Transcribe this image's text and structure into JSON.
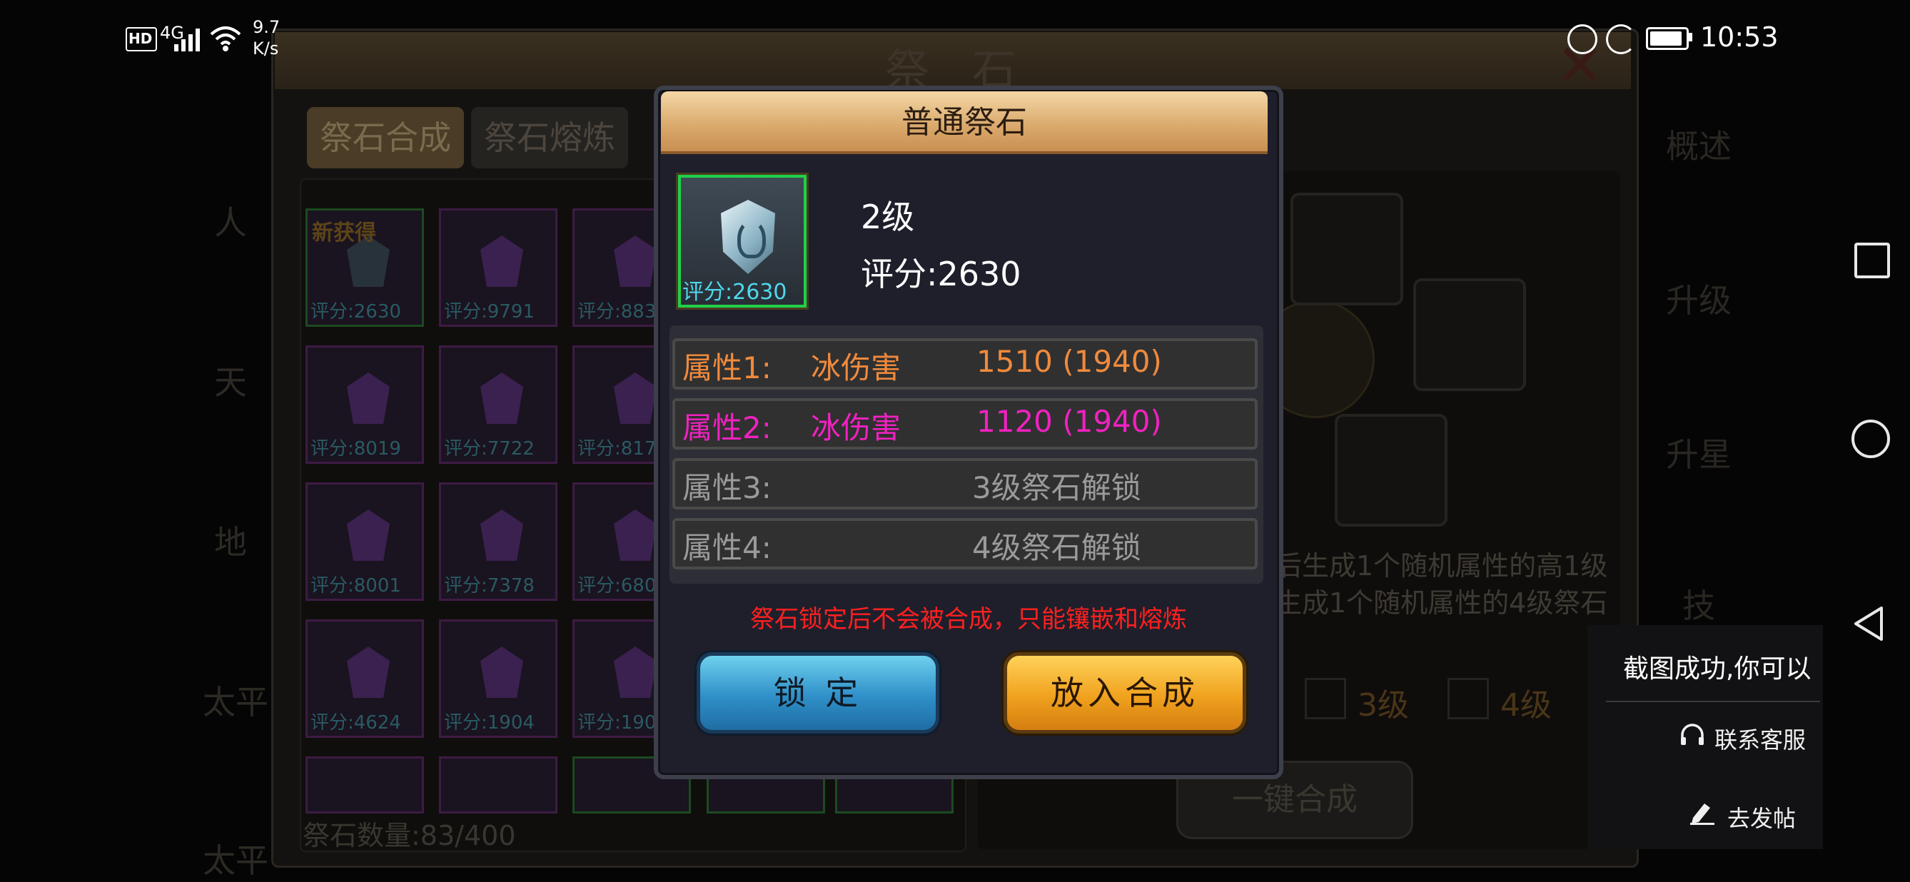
{
  "status_bar": {
    "network_badge": "HD",
    "network_type": "4G",
    "speed_value": "9.7",
    "speed_unit": "K/s",
    "time": "10:53"
  },
  "game": {
    "title": "祭 石",
    "tabs": [
      "祭石合成",
      "祭石熔炼"
    ],
    "inventory": {
      "new_tag": "新获得",
      "slots": [
        {
          "score": "评分:2630",
          "type": "ice"
        },
        {
          "score": "评分:9791",
          "type": "purple"
        },
        {
          "score": "评分:883",
          "type": "purple"
        },
        {
          "score": "评分:8019",
          "type": "purple"
        },
        {
          "score": "评分:7722",
          "type": "purple"
        },
        {
          "score": "评分:817",
          "type": "purple"
        },
        {
          "score": "评分:8001",
          "type": "purple"
        },
        {
          "score": "评分:7378",
          "type": "purple"
        },
        {
          "score": "评分:680",
          "type": "purple"
        },
        {
          "score": "评分:4624",
          "type": "purple"
        },
        {
          "score": "评分:1904",
          "type": "purple"
        },
        {
          "score": "评分:190",
          "type": "purple"
        }
      ],
      "count_label": "祭石数量:83/400"
    },
    "side_labels": [
      "人",
      "天",
      "地",
      "太平",
      "太平"
    ],
    "vertical_tabs": [
      "概述",
      "升级",
      "升星",
      "技"
    ],
    "synthesis": {
      "desc_line_1": "后生成1个随机属性的高1级",
      "desc_line_2": "生成1个随机属性的4级祭石",
      "level_options": [
        "3级",
        "4级"
      ],
      "one_key_button": "一键合成"
    }
  },
  "dialog": {
    "title": "普通祭石",
    "item": {
      "score_caption": "评分:2630",
      "level": "2级",
      "rating": "评分:2630"
    },
    "attributes": [
      {
        "name": "属性1:",
        "value": "冰伤害",
        "number": "1510 (1940)",
        "color": "#f08a3c"
      },
      {
        "name": "属性2:",
        "value": "冰伤害",
        "number": "1120 (1940)",
        "color": "#f021c0"
      },
      {
        "name": "属性3:",
        "value": "3级祭石解锁",
        "number": "",
        "color": "#9a9a9a"
      },
      {
        "name": "属性4:",
        "value": "4级祭石解锁",
        "number": "",
        "color": "#9a9a9a"
      }
    ],
    "lock_note": "祭石锁定后不会被合成，只能镶嵌和熔炼",
    "lock_button": "锁 定",
    "synth_button": "放入合成"
  },
  "toast": {
    "title": "截图成功,你可以",
    "contact": "联系客服",
    "post": "去发帖"
  }
}
